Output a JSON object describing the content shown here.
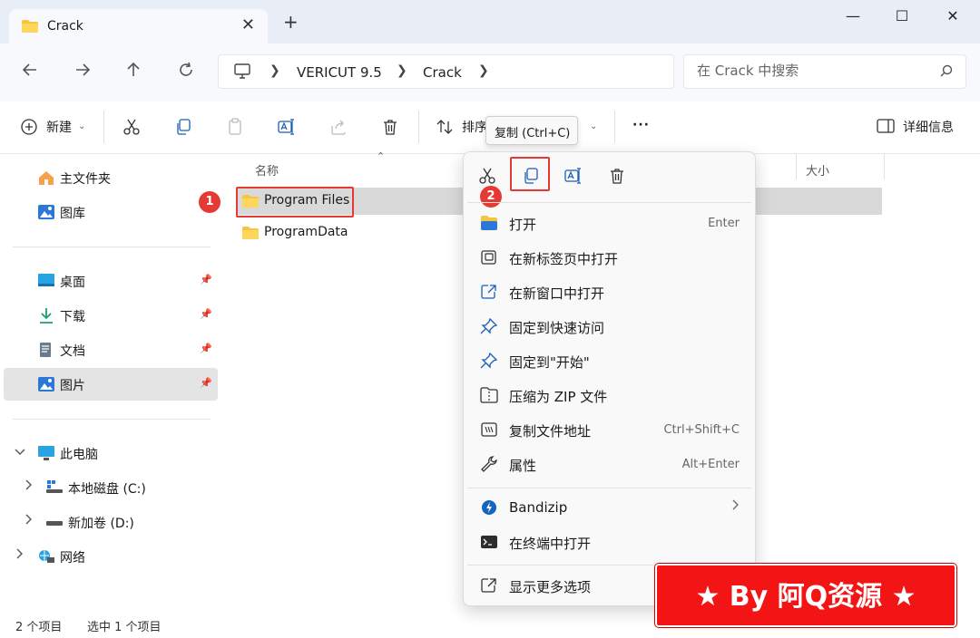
{
  "window": {
    "tab_title": "Crack",
    "tab_close": "✕",
    "new_tab": "+",
    "minimize": "—",
    "maximize": "☐",
    "close": "✕"
  },
  "address": {
    "crumbs": [
      "VERICUT 9.5",
      "Crack"
    ],
    "search_placeholder": "在 Crack 中搜索"
  },
  "toolbar": {
    "new_label": "新建",
    "sort_label": "排序",
    "more_label": "···",
    "details_label": "详细信息"
  },
  "tooltip": {
    "text": "复制 (Ctrl+C)"
  },
  "sidebar": {
    "top": [
      {
        "label": "主文件夹",
        "icon": "home-icon"
      },
      {
        "label": "图库",
        "icon": "gallery-icon"
      }
    ],
    "quick": [
      {
        "label": "桌面",
        "icon": "desktop-icon"
      },
      {
        "label": "下载",
        "icon": "download-icon"
      },
      {
        "label": "文档",
        "icon": "document-icon"
      },
      {
        "label": "图片",
        "icon": "pictures-icon"
      }
    ],
    "pc": {
      "label": "此电脑"
    },
    "drives": [
      {
        "label": "本地磁盘 (C:)"
      },
      {
        "label": "新加卷 (D:)"
      }
    ],
    "network": {
      "label": "网络"
    }
  },
  "files": {
    "columns": {
      "name": "名称",
      "size": "大小"
    },
    "items": [
      {
        "name": "Program Files",
        "selected": true
      },
      {
        "name": "ProgramData",
        "selected": false
      }
    ]
  },
  "annotations": {
    "step1": "1",
    "step2": "2"
  },
  "context_menu": {
    "items": [
      {
        "label": "打开",
        "shortcut": "Enter"
      },
      {
        "label": "在新标签页中打开",
        "shortcut": ""
      },
      {
        "label": "在新窗口中打开",
        "shortcut": ""
      },
      {
        "label": "固定到快速访问",
        "shortcut": ""
      },
      {
        "label": "固定到\"开始\"",
        "shortcut": ""
      },
      {
        "label": "压缩为 ZIP 文件",
        "shortcut": ""
      },
      {
        "label": "复制文件地址",
        "shortcut": "Ctrl+Shift+C"
      },
      {
        "label": "属性",
        "shortcut": "Alt+Enter"
      }
    ],
    "bandizip": "Bandizip",
    "terminal": "在终端中打开",
    "more_options": "显示更多选项"
  },
  "status": {
    "count": "2 个项目",
    "selected": "选中 1 个项目"
  },
  "banner": {
    "text": "★ By 阿Q资源 ★"
  },
  "colors": {
    "accent": "#0067c0",
    "annotation_red": "#e53935",
    "banner_red": "#f31515"
  }
}
